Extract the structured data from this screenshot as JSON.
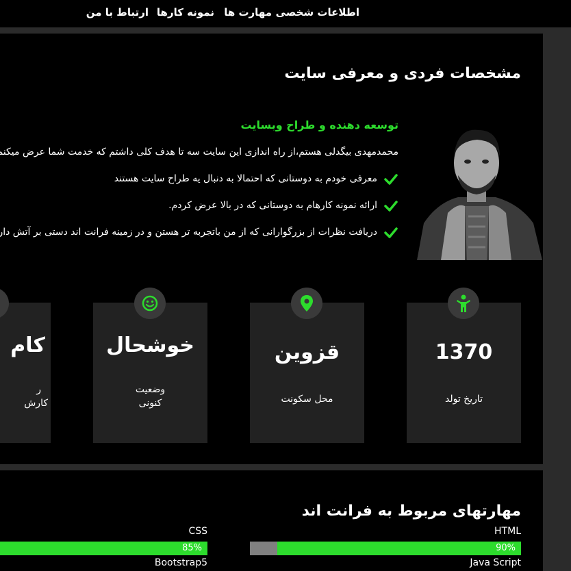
{
  "nav": {
    "items": [
      {
        "label": "اطلاعات شخصی"
      },
      {
        "label": "مهارت ها"
      },
      {
        "label": "نمونه کارها"
      },
      {
        "label": "ارتباط با من"
      }
    ]
  },
  "about": {
    "title": "مشخصات فردی و معرفی سایت",
    "subtitle": "توسعه دهنده و طراح وبسایت",
    "intro": "محمدمهدی بیگدلی هستم،از راه اندازی این سایت سه تا هدف کلی داشتم که خدمت شما عرض میکنم",
    "bullets": [
      "معرفی خودم به دوستانی که احتمالا به دنبال یه طراح سایت هستند",
      "ارائه نمونه کارهام به دوستانی که در بالا عرض کردم.",
      "دریافت نظرات از بزرگوارانی که از من باتجربه تر هستن و در زمینه فرانت اند دستی بر آتش دارند"
    ]
  },
  "cards": [
    {
      "icon": "person-icon",
      "value": "1370",
      "label": "تاریخ تولد"
    },
    {
      "icon": "location-pin-icon",
      "value": "قزوین",
      "label": "محل سکونت"
    },
    {
      "icon": "smiley-icon",
      "value": "خوشحال",
      "label_line1": "وضعیت",
      "label_line2": "کنونی"
    },
    {
      "icon": "send-icon",
      "value": "کام",
      "label_line1": "ر",
      "label_line2": "کارش"
    }
  ],
  "skills": {
    "title": "مهارتهای مربوط به فرانت اند",
    "items": [
      {
        "name": "HTML",
        "percent": 90,
        "percent_label": "90%"
      },
      {
        "name": "CSS",
        "percent": 85,
        "percent_label": "85%"
      },
      {
        "name": "Java Script"
      },
      {
        "name": "Bootstrap5"
      }
    ]
  },
  "colors": {
    "accent": "#2ddc2d",
    "background": "#000000",
    "page": "#2b2b2b",
    "card": "#222222"
  }
}
